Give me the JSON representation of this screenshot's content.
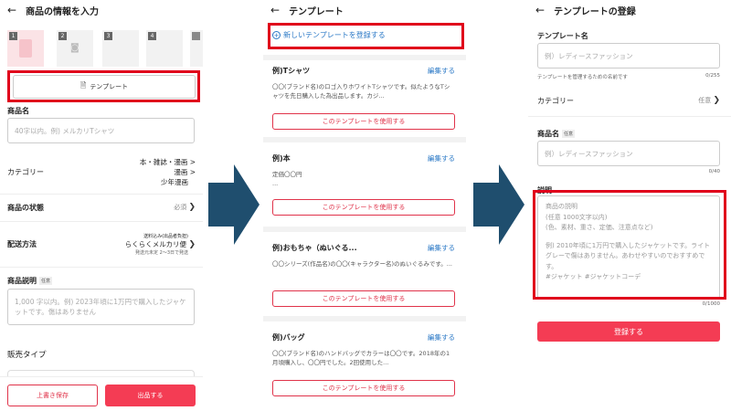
{
  "panel1": {
    "title": "商品の情報を入力",
    "thumbs": [
      "1",
      "2",
      "3",
      "4"
    ],
    "template_button": "テンプレート",
    "product_name_label": "商品名",
    "product_name_placeholder": "40字以内。例) メルカリTシャツ",
    "category_label": "カテゴリー",
    "category_values": [
      "本・雑誌・漫画 >",
      "漫画 >",
      "少年漫画"
    ],
    "condition_label": "商品の状態",
    "condition_value": "必須",
    "shipping_label": "配送方法",
    "shipping_note": "送料込み(出品者負担)",
    "shipping_value": "らくらくメルカリ便",
    "shipping_sub": "発送元未定 2〜3日で発送",
    "desc_label": "商品説明",
    "desc_tag": "任意",
    "desc_placeholder": "1,000 字以内。例) 2023年頃に1万円で購入したジャケットです。傷はありません",
    "sales_type_label": "販売タイプ",
    "save_draft": "上書き保存",
    "list_button": "出品する"
  },
  "panel2": {
    "title": "テンプレート",
    "new_template": "新しいテンプレートを登録する",
    "edit_label": "編集する",
    "use_label": "このテンプレートを使用する",
    "cards": [
      {
        "title": "例)Tシャツ",
        "desc": "〇〇(ブランド名)のロゴ入りホワイトTシャツです。似たようなTシャツを先日購入した為出品します。カジ..."
      },
      {
        "title": "例)本",
        "desc": "定価〇〇円\n..."
      },
      {
        "title": "例)おもちゃ（ぬいぐる...",
        "desc": "〇〇シリーズ(作品名)の〇〇(キャラクター名)のぬいぐるみです。..."
      },
      {
        "title": "例)バッグ",
        "desc": "〇〇(ブランド名)のハンドバッグでカラーは〇〇です。2018年の1月頃購入し、〇〇円でした。2回使用した..."
      }
    ]
  },
  "panel3": {
    "title": "テンプレートの登録",
    "template_name_label": "テンプレート名",
    "template_name_placeholder": "例）レディースファッション",
    "template_name_hint": "テンプレートを管理するための名前です",
    "template_name_count": "0/255",
    "category_label": "カテゴリー",
    "category_value": "任意",
    "product_name_label": "商品名",
    "product_name_tag": "任意",
    "product_name_placeholder": "例）レディースファッション",
    "product_name_count": "0/40",
    "desc_label": "説明",
    "desc_placeholder_lines": [
      "商品の説明",
      "(任意 1000文字以内)",
      "(色、素材、重さ、定価、注意点など)",
      "",
      "例) 2010年頃に1万円で購入したジャケットです。ライトグレーで傷はありません。あわせやすいのでおすすめです。",
      "#ジャケット #ジャケットコーデ"
    ],
    "desc_count": "0/1000",
    "register_button": "登録する"
  },
  "colors": {
    "highlight": "#e0001b",
    "arrow": "#1f4e6e",
    "brand_red": "#f43c54",
    "link_blue": "#2a78c6"
  }
}
